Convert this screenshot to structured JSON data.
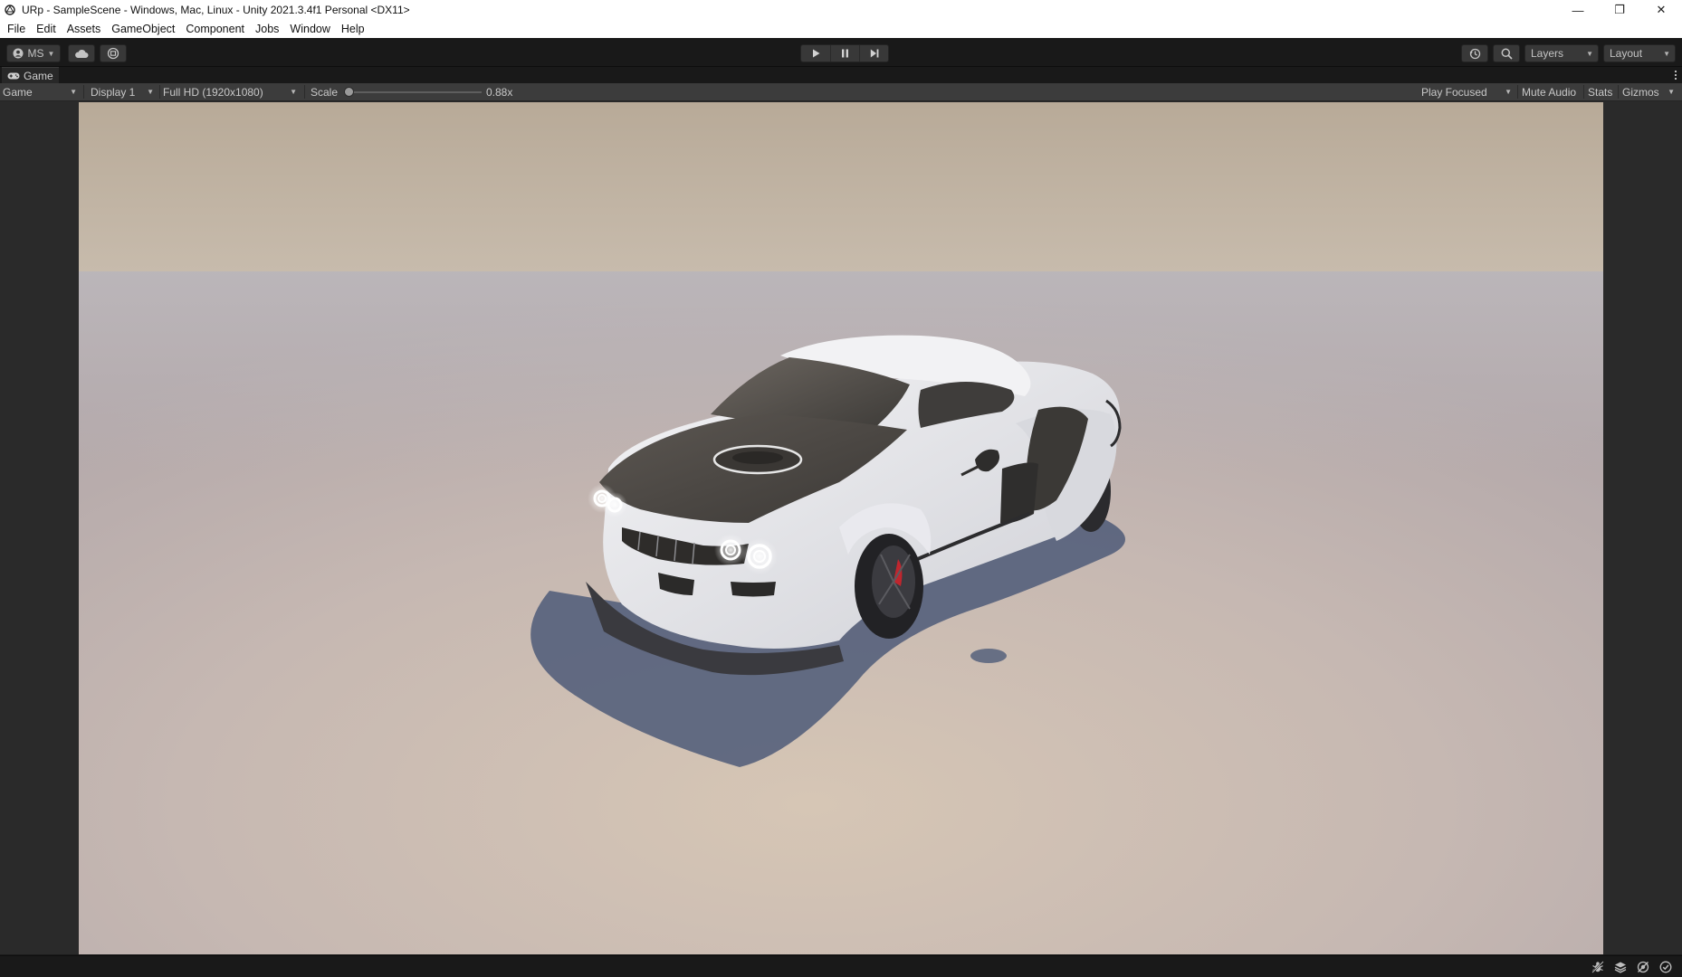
{
  "window": {
    "title": "URp - SampleScene - Windows, Mac, Linux - Unity 2021.3.4f1 Personal <DX11>",
    "minimize_glyph": "—",
    "restore_glyph": "❐",
    "close_glyph": "✕"
  },
  "menu": {
    "items": [
      "File",
      "Edit",
      "Assets",
      "GameObject",
      "Component",
      "Jobs",
      "Window",
      "Help"
    ]
  },
  "toolbar": {
    "account_label": "MS",
    "layers_label": "Layers",
    "layout_label": "Layout",
    "icons": [
      "account-icon",
      "cloud-icon",
      "collab-icon",
      "play-icon",
      "pause-icon",
      "step-icon",
      "history-icon",
      "search-icon"
    ]
  },
  "tab": {
    "label": "Game",
    "icon": "gamepad-icon"
  },
  "game_toolbar": {
    "view_mode": "Game",
    "display": "Display 1",
    "resolution": "Full HD (1920x1080)",
    "scale_label": "Scale",
    "scale_value": "0.88x",
    "play_mode": "Play Focused",
    "mute_audio": "Mute Audio",
    "stats": "Stats",
    "gizmos": "Gizmos"
  },
  "status": {
    "icons": [
      "bug-icon",
      "layers-stack-icon",
      "network-off-icon",
      "checkmark-circle-icon"
    ]
  },
  "colors": {
    "editor_bg": "#191919",
    "panel_bg": "#3c3c3c",
    "sky_top": "#b9ab9b",
    "ground": "#c4b8b4",
    "car_body": "#e8e8ec",
    "car_hood": "#4a4642",
    "headlight": "#ffffff",
    "brake_caliper": "#c0262e",
    "shadow": "#4f5d7a"
  }
}
